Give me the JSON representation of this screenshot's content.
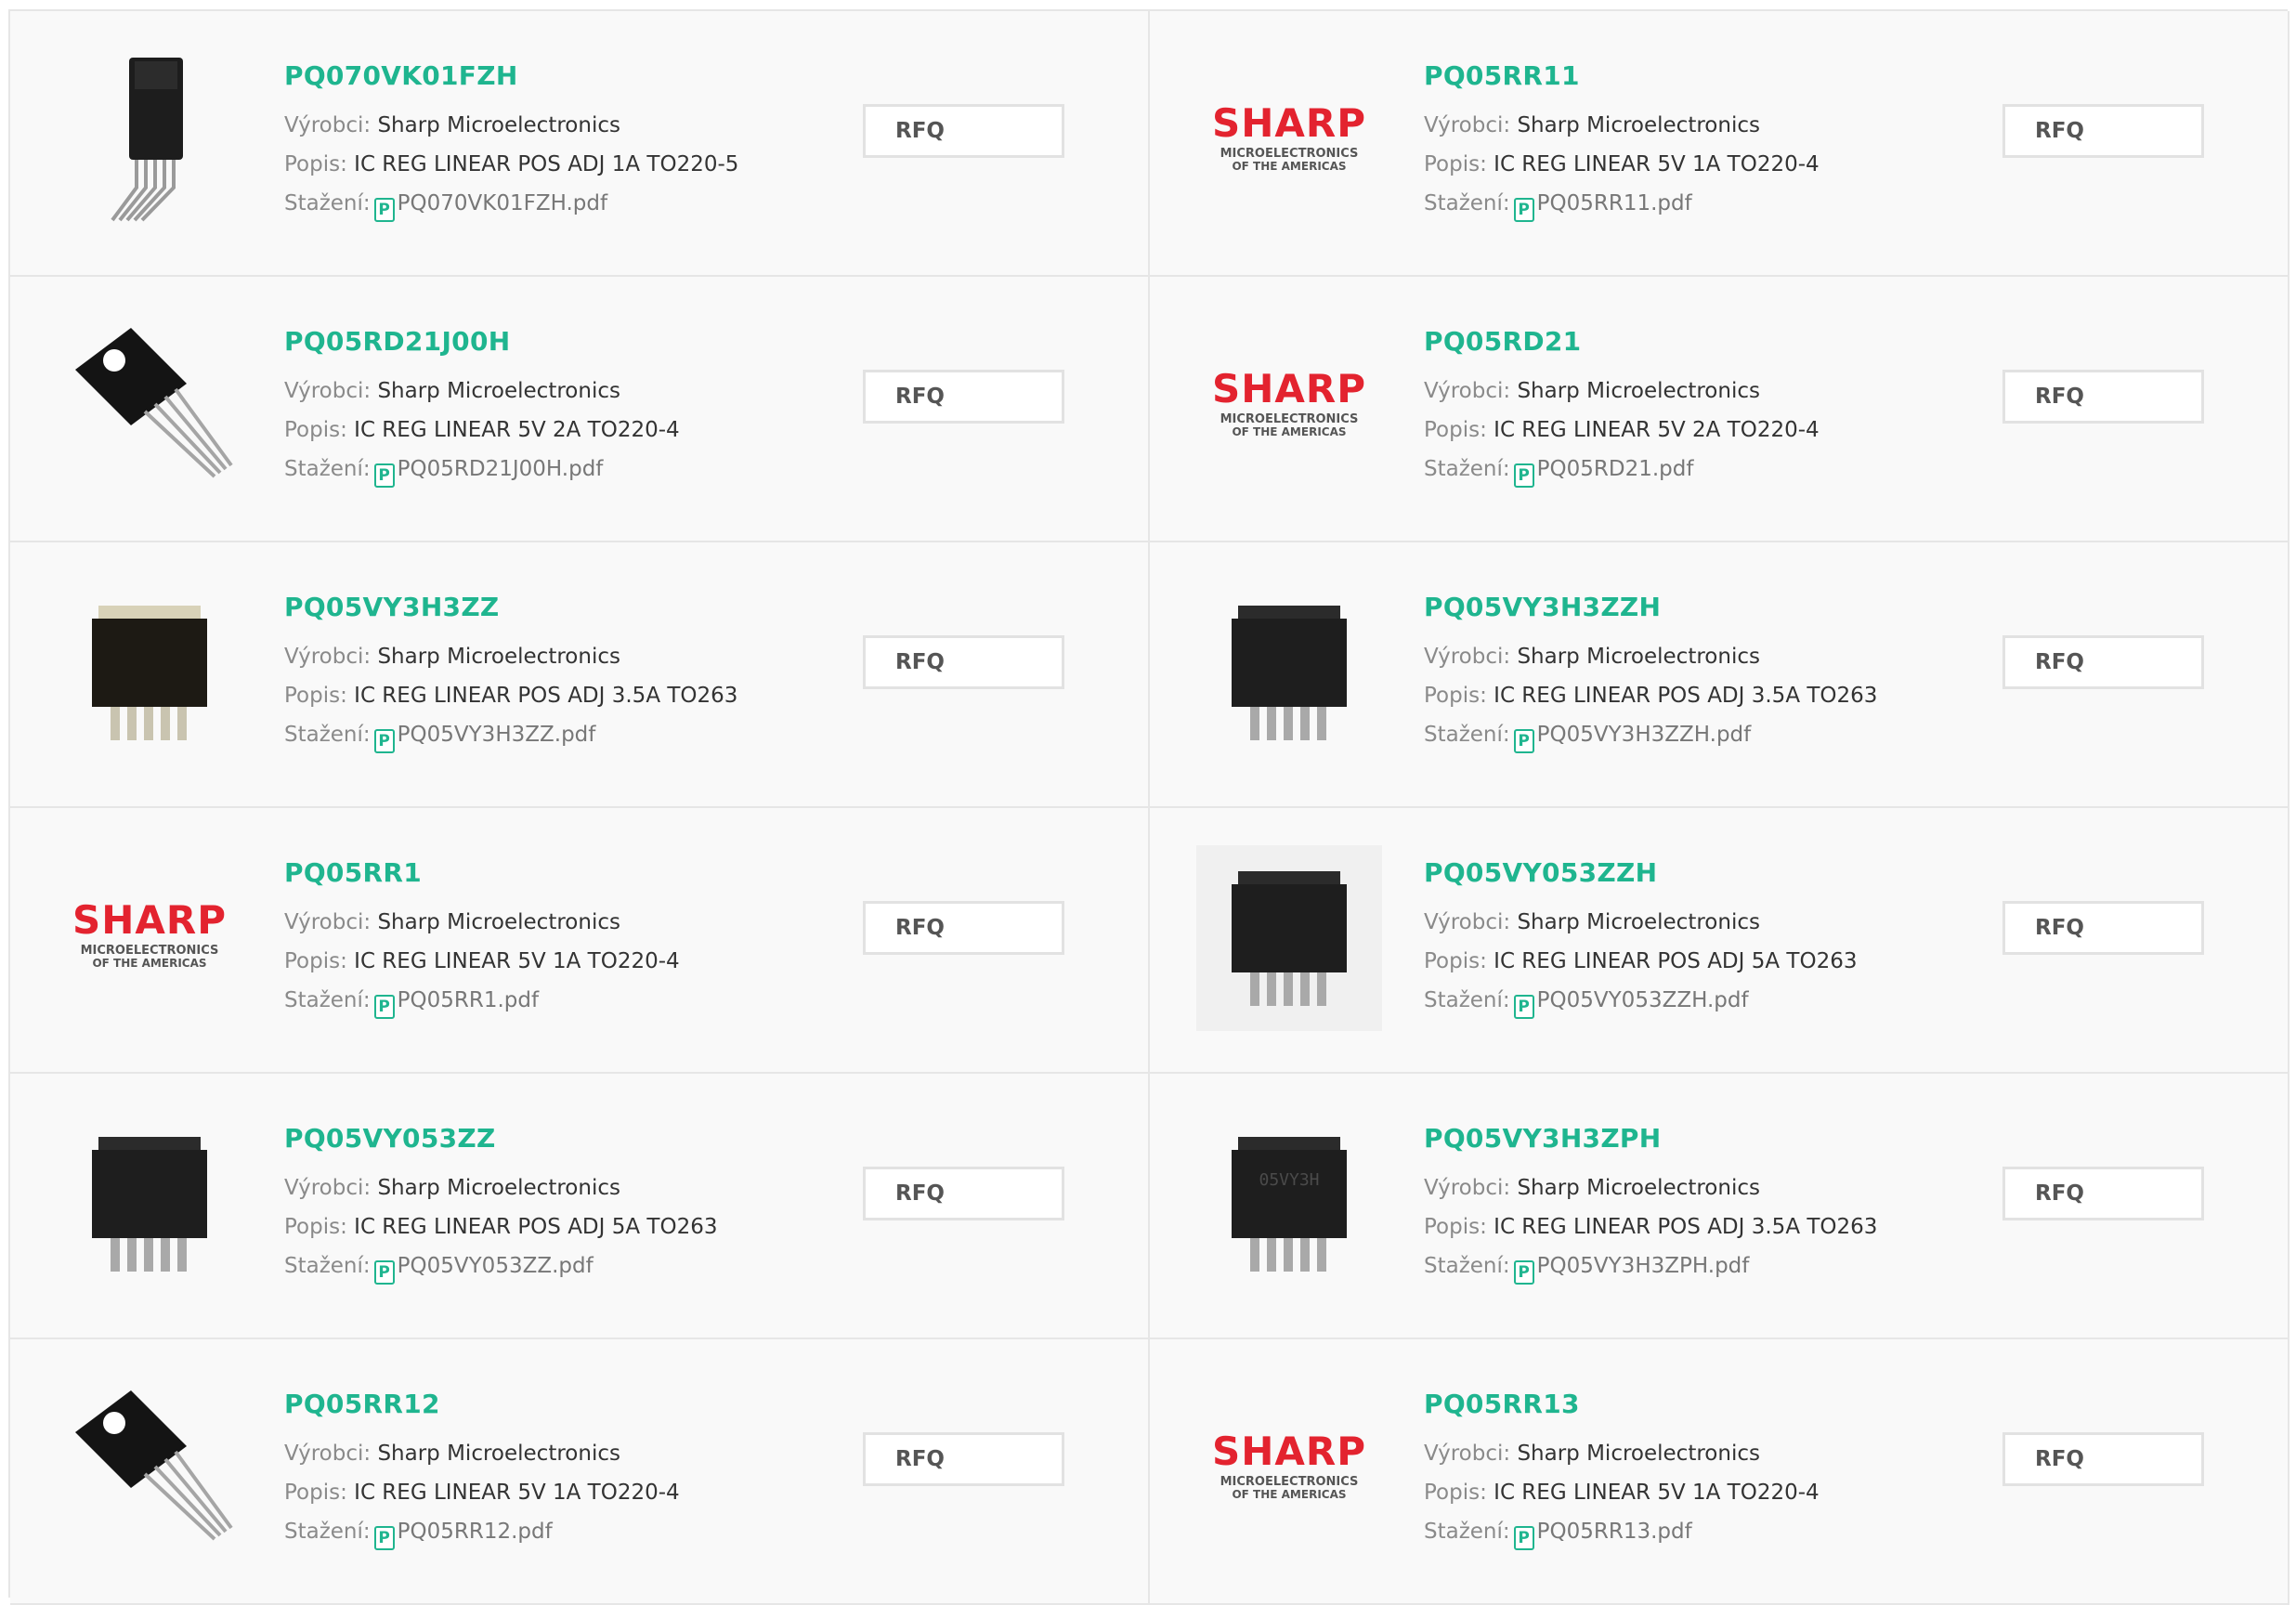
{
  "labels": {
    "manufacturer": "Výrobci:",
    "description": "Popis:",
    "download": "Stažení:"
  },
  "rfq_label": "RFQ",
  "pdf_icon_glyph": "P",
  "accent_color": "#1fb58f",
  "brand_color": "#e3232f",
  "products": [
    {
      "part_number": "PQ070VK01FZH",
      "manufacturer": "Sharp Microelectronics",
      "description": "IC REG LINEAR POS ADJ 1A TO220-5",
      "datasheet": "PQ070VK01FZH.pdf",
      "image": "to220-5-upright"
    },
    {
      "part_number": "PQ05RR11",
      "manufacturer": "Sharp Microelectronics",
      "description": "IC REG LINEAR 5V 1A TO220-4",
      "datasheet": "PQ05RR11.pdf",
      "image": "sharp-logo",
      "logo": {
        "brand": "SHARP",
        "line1": "MICROELECTRONICS",
        "line2": "OF THE AMERICAS"
      }
    },
    {
      "part_number": "PQ05RD21J00H",
      "manufacturer": "Sharp Microelectronics",
      "description": "IC REG LINEAR 5V 2A TO220-4",
      "datasheet": "PQ05RD21J00H.pdf",
      "image": "to220-4-angled"
    },
    {
      "part_number": "PQ05RD21",
      "manufacturer": "Sharp Microelectronics",
      "description": "IC REG LINEAR 5V 2A TO220-4",
      "datasheet": "PQ05RD21.pdf",
      "image": "sharp-logo",
      "logo": {
        "brand": "SHARP",
        "line1": "MICROELECTRONICS",
        "line2": "OF THE AMERICAS"
      }
    },
    {
      "part_number": "PQ05VY3H3ZZ",
      "manufacturer": "Sharp Microelectronics",
      "description": "IC REG LINEAR POS ADJ 3.5A TO263",
      "datasheet": "PQ05VY3H3ZZ.pdf",
      "image": "to263-tan"
    },
    {
      "part_number": "PQ05VY3H3ZZH",
      "manufacturer": "Sharp Microelectronics",
      "description": "IC REG LINEAR POS ADJ 3.5A TO263",
      "datasheet": "PQ05VY3H3ZZH.pdf",
      "image": "to263"
    },
    {
      "part_number": "PQ05RR1",
      "manufacturer": "Sharp Microelectronics",
      "description": "IC REG LINEAR 5V 1A TO220-4",
      "datasheet": "PQ05RR1.pdf",
      "image": "sharp-logo",
      "logo": {
        "brand": "SHARP",
        "line1": "MICROELECTRONICS",
        "line2": "OF THE AMERICAS"
      }
    },
    {
      "part_number": "PQ05VY053ZZH",
      "manufacturer": "Sharp Microelectronics",
      "description": "IC REG LINEAR POS ADJ 5A TO263",
      "datasheet": "PQ05VY053ZZH.pdf",
      "image": "to263-photo"
    },
    {
      "part_number": "PQ05VY053ZZ",
      "manufacturer": "Sharp Microelectronics",
      "description": "IC REG LINEAR POS ADJ 5A TO263",
      "datasheet": "PQ05VY053ZZ.pdf",
      "image": "to263"
    },
    {
      "part_number": "PQ05VY3H3ZPH",
      "manufacturer": "Sharp Microelectronics",
      "description": "IC REG LINEAR POS ADJ 3.5A TO263",
      "datasheet": "PQ05VY3H3ZPH.pdf",
      "image": "to263-marked"
    },
    {
      "part_number": "PQ05RR12",
      "manufacturer": "Sharp Microelectronics",
      "description": "IC REG LINEAR 5V 1A TO220-4",
      "datasheet": "PQ05RR12.pdf",
      "image": "to220-4-angled"
    },
    {
      "part_number": "PQ05RR13",
      "manufacturer": "Sharp Microelectronics",
      "description": "IC REG LINEAR 5V 1A TO220-4",
      "datasheet": "PQ05RR13.pdf",
      "image": "sharp-logo",
      "logo": {
        "brand": "SHARP",
        "line1": "MICROELECTRONICS",
        "line2": "OF THE AMERICAS"
      }
    }
  ]
}
